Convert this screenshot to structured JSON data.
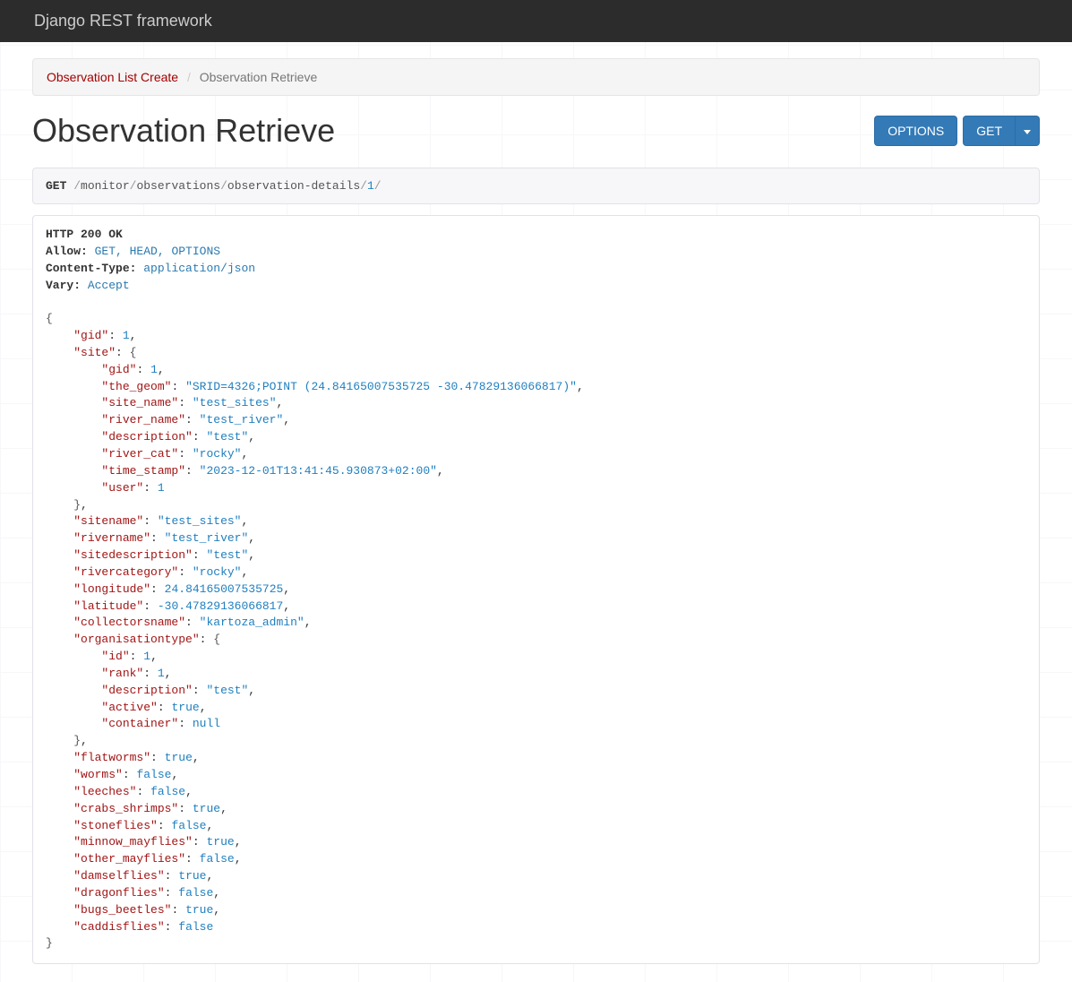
{
  "navbar": {
    "title": "Django REST framework"
  },
  "breadcrumb": {
    "parent": "Observation List Create",
    "current": "Observation Retrieve"
  },
  "header": {
    "title": "Observation Retrieve"
  },
  "buttons": {
    "options": "OPTIONS",
    "get": "GET"
  },
  "request": {
    "method": "GET",
    "path_segments": [
      "monitor",
      "observations",
      "observation-details"
    ],
    "path_id": "1"
  },
  "response": {
    "status_line": "HTTP 200 OK",
    "headers": {
      "Allow": "GET, HEAD, OPTIONS",
      "Content-Type": "application/json",
      "Vary": "Accept"
    },
    "body": {
      "gid": 1,
      "site": {
        "gid": 1,
        "the_geom": "SRID=4326;POINT (24.84165007535725 -30.47829136066817)",
        "site_name": "test_sites",
        "river_name": "test_river",
        "description": "test",
        "river_cat": "rocky",
        "time_stamp": "2023-12-01T13:41:45.930873+02:00",
        "user": 1
      },
      "sitename": "test_sites",
      "rivername": "test_river",
      "sitedescription": "test",
      "rivercategory": "rocky",
      "longitude": 24.84165007535725,
      "latitude": -30.47829136066817,
      "collectorsname": "kartoza_admin",
      "organisationtype": {
        "id": 1,
        "rank": 1,
        "description": "test",
        "active": true,
        "container": null
      },
      "flatworms": true,
      "worms": false,
      "leeches": false,
      "crabs_shrimps": true,
      "stoneflies": false,
      "minnow_mayflies": true,
      "other_mayflies": false,
      "damselflies": true,
      "dragonflies": false,
      "bugs_beetles": true,
      "caddisflies": false
    }
  }
}
